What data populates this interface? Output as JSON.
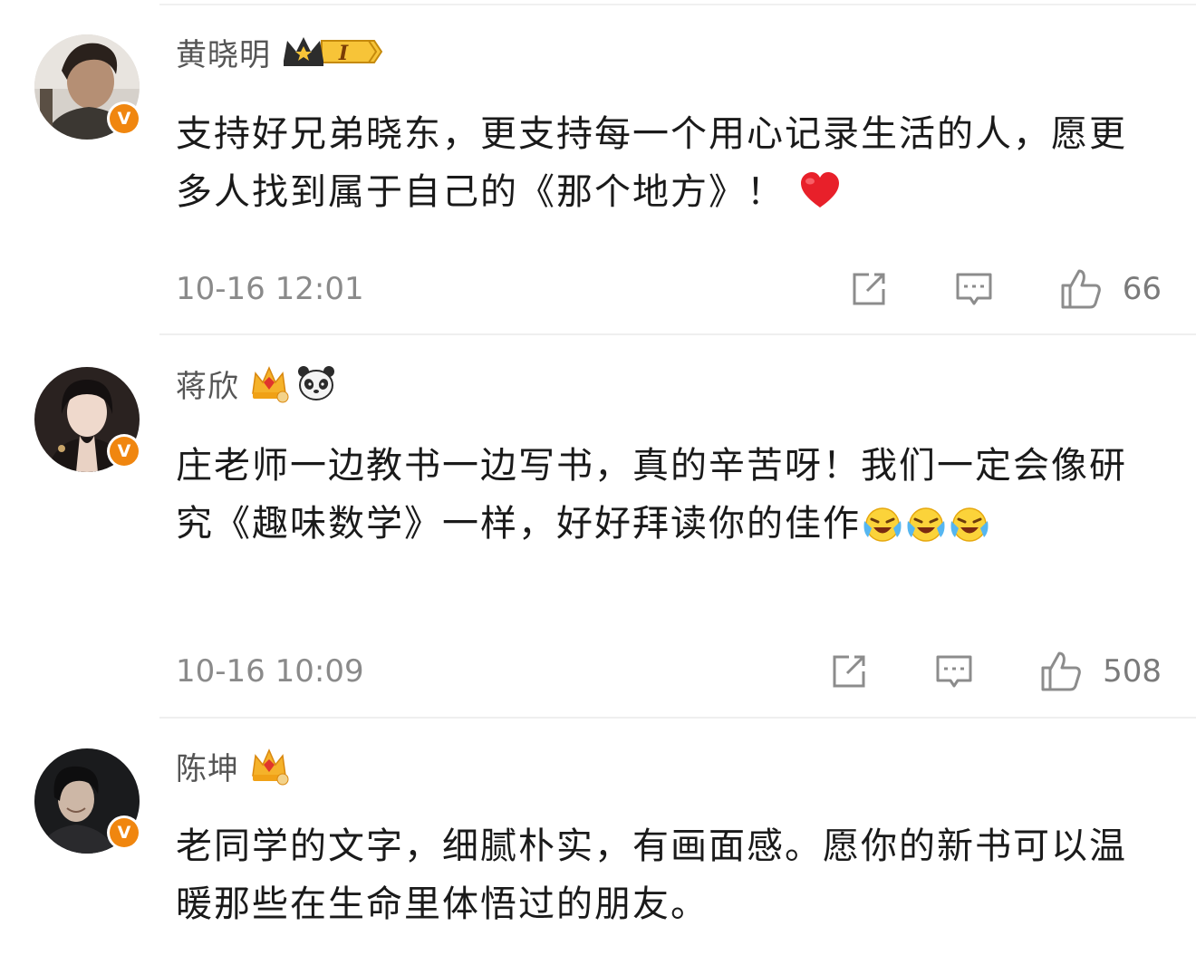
{
  "comments": [
    {
      "user": "黄晓明",
      "badge": {
        "type": "crown-level",
        "level": "I"
      },
      "text_parts": [
        "支持好兄弟晓东，更支持每一个用心记录生活的人，愿更多人找到属于自己的《那个地方》！"
      ],
      "emoji": "heart",
      "timestamp": "10-16 12:01",
      "likes": "66"
    },
    {
      "user": "蒋欣",
      "badge": {
        "type": "gem-crown",
        "extra": "panda"
      },
      "text_parts": [
        "庄老师一边教书一边写书，真的辛苦呀！我们一定会像研究《趣味数学》一样，好好拜读你的佳作"
      ],
      "emoji": "laugh-cry",
      "timestamp": "10-16 10:09",
      "likes": "508"
    },
    {
      "user": "陈坤",
      "badge": {
        "type": "gem-crown"
      },
      "text_parts": [
        "老同学的文字，细腻朴实，有画面感。愿你的新书可以温暖那些在生命里体悟过的朋友。"
      ]
    }
  ],
  "colors": {
    "name": "#555555",
    "text": "#1a1a1a",
    "meta": "#8a8a8a",
    "verified": "#f0860f",
    "heart": "#e8202a"
  },
  "icons": {
    "verified": "verified-v-icon",
    "share": "share-icon",
    "reply": "reply-icon",
    "like": "thumbs-up-icon"
  }
}
